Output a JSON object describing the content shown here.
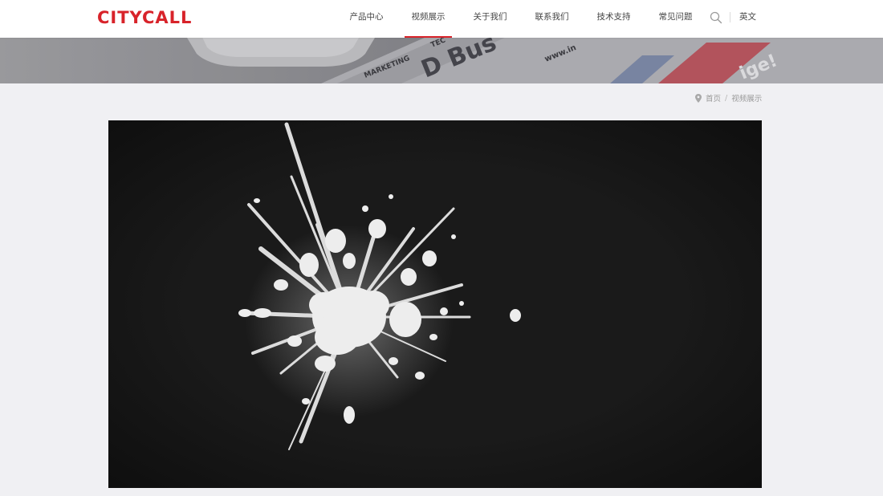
{
  "header": {
    "logo": "CITYCALL",
    "nav": [
      {
        "label": "产品中心",
        "active": false
      },
      {
        "label": "视频展示",
        "active": true
      },
      {
        "label": "关于我们",
        "active": false
      },
      {
        "label": "联系我们",
        "active": false
      },
      {
        "label": "技术支持",
        "active": false
      },
      {
        "label": "常见问题",
        "active": false
      }
    ],
    "language": "英文"
  },
  "banner": {
    "texts": [
      "MARKETING",
      "TEC",
      "D Bus",
      "www.in",
      "ige!"
    ]
  },
  "breadcrumb": {
    "home": "首页",
    "separator": "/",
    "current": "视频展示"
  },
  "colors": {
    "brand": "#d8232a",
    "page_background": "#f0f0f3",
    "video_background": "#141414"
  },
  "icons": {
    "search": "search-icon",
    "location": "location-pin-icon"
  }
}
